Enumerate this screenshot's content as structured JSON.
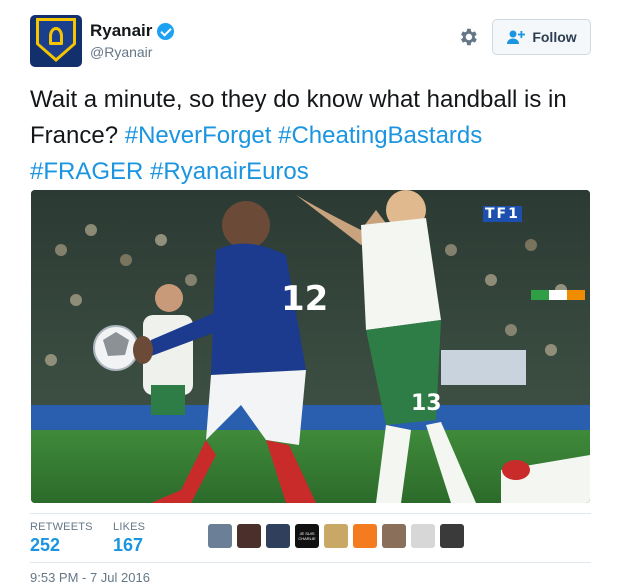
{
  "author": {
    "display_name": "Ryanair",
    "handle": "@Ryanair",
    "verified": true,
    "avatar_icon": "ryanair-crest-avatar"
  },
  "actions": {
    "follow_label": "Follow",
    "settings_icon": "gear-icon",
    "follow_icon": "add-user-icon"
  },
  "tweet": {
    "text": "Wait a minute, so they do know what handball is in France?",
    "hashtags": [
      "#NeverForget",
      "#CheatingBastards",
      "#FRAGER",
      "#RyanairEuros"
    ]
  },
  "media": {
    "description_icon": "football-match-photo",
    "broadcaster_logo": "TF1"
  },
  "stats": {
    "retweets_label": "RETWEETS",
    "retweets_value": "252",
    "likes_label": "LIKES",
    "likes_value": "167"
  },
  "likers": [
    {
      "name": "liker-avatar-1",
      "color": "#6b7f96"
    },
    {
      "name": "liker-avatar-2",
      "color": "#4a2f2a"
    },
    {
      "name": "liker-avatar-3",
      "color": "#2f3f5c"
    },
    {
      "name": "liker-avatar-4",
      "color": "#111111",
      "text": "JE SUIS CHARLIE"
    },
    {
      "name": "liker-avatar-5",
      "color": "#c9a766"
    },
    {
      "name": "liker-avatar-6",
      "color": "#f47b20"
    },
    {
      "name": "liker-avatar-7",
      "color": "#8a6f5a"
    },
    {
      "name": "liker-avatar-8",
      "color": "#d7d7d7"
    },
    {
      "name": "liker-avatar-9",
      "color": "#3a3a3a"
    }
  ],
  "timestamp": "9:53 PM - 7 Jul 2016",
  "colors": {
    "link": "#1b95e0",
    "text": "#14171a",
    "muted": "#657786"
  }
}
